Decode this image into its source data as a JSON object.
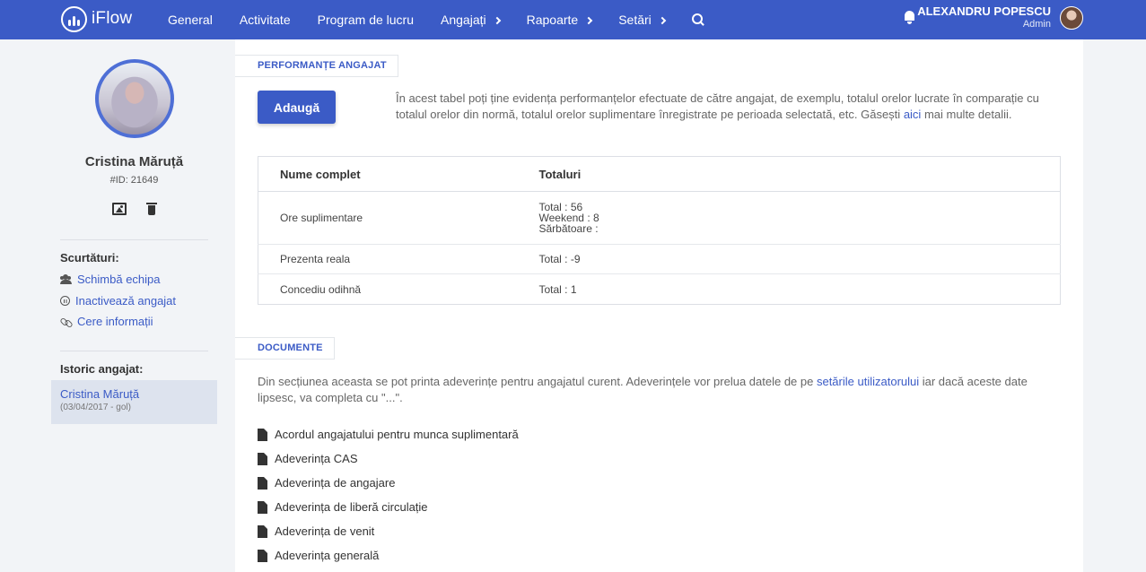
{
  "header": {
    "brand": "iFlow",
    "nav": [
      {
        "label": "General",
        "has_chevron": false
      },
      {
        "label": "Activitate",
        "has_chevron": false
      },
      {
        "label": "Program de lucru",
        "has_chevron": false
      },
      {
        "label": "Angajați",
        "has_chevron": true
      },
      {
        "label": "Rapoarte",
        "has_chevron": true
      },
      {
        "label": "Setări",
        "has_chevron": true
      }
    ],
    "icons": {
      "search": "search-icon",
      "notifications": "bell-icon"
    },
    "user": {
      "name": "ALEXANDRU POPESCU",
      "role": "Admin"
    }
  },
  "profile": {
    "name": "Cristina Măruță",
    "id": "#ID: 21649",
    "actions": [
      "image-icon",
      "trash-icon"
    ]
  },
  "shortcuts": {
    "heading": "Scurtături:",
    "items": [
      {
        "label": "Schimbă echipa",
        "icon": "users-icon"
      },
      {
        "label": "Inactivează angajat",
        "icon": "pause-circle-icon"
      },
      {
        "label": "Cere informații",
        "icon": "link-icon"
      }
    ]
  },
  "history": {
    "heading": "Istoric angajat:",
    "items": [
      {
        "name": "Cristina Măruță",
        "dates": "(03/04/2017 - gol)"
      }
    ]
  },
  "performance": {
    "section_title": "PERFORMANȚE ANGAJAT",
    "add_button": "Adaugă",
    "intro_text": "În acest tabel poți ține evidența performanțelor efectuate de către angajat, de exemplu, totalul orelor lucrate în comparație cu totalul orelor din normă, totalul orelor suplimentare înregistrate pe perioada selectată, etc. Găsești ",
    "intro_link": "aici",
    "intro_suffix": " mai multe detalii.",
    "columns": [
      "Nume complet",
      "Totaluri"
    ],
    "rows": [
      {
        "name": "Ore suplimentare",
        "totals": [
          "Total : 56",
          "Weekend : 8",
          "Sărbătoare :"
        ]
      },
      {
        "name": "Prezenta reala",
        "totals": [
          "Total : -9"
        ]
      },
      {
        "name": "Concediu odihnă",
        "totals": [
          "Total : 1"
        ]
      }
    ]
  },
  "documents": {
    "section_title": "DOCUMENTE",
    "intro_text": "Din secțiunea aceasta se pot printa adeverințe pentru angajatul curent. Adeverințele vor prelua datele de pe ",
    "intro_link": "setările utilizatorului",
    "intro_suffix": " iar dacă aceste date lipsesc, va completa cu \"...\".",
    "items": [
      "Acordul angajatului pentru munca suplimentară",
      "Adeverința CAS",
      "Adeverința de angajare",
      "Adeverința de liberă circulație",
      "Adeverința de venit",
      "Adeverința generală"
    ]
  },
  "colors": {
    "primary": "#3b5bc6",
    "background": "#f2f4f7",
    "panel": "#ffffff",
    "history_highlight": "#dde3ee"
  }
}
